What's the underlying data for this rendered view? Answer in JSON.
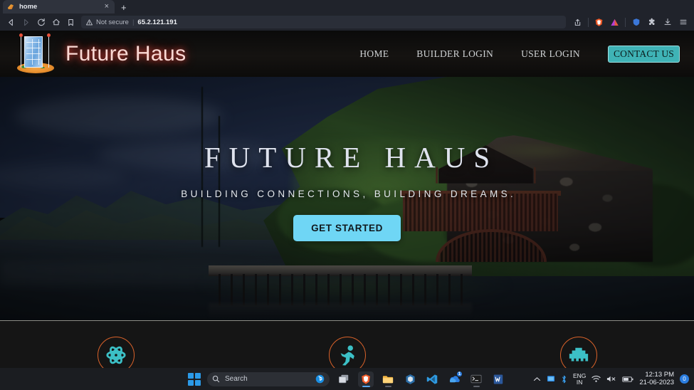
{
  "browser": {
    "tab": {
      "title": "home",
      "close_label": "×",
      "favicon": "brave-lion-favicon"
    },
    "newtab_label": "+",
    "nav": {
      "back": "back-arrow-icon",
      "forward": "forward-arrow-icon",
      "reload": "reload-icon",
      "home": "home-icon",
      "bookmark": "bookmark-icon"
    },
    "omnibox": {
      "security_label": "Not secure",
      "separator": "|",
      "url": "65.2.121.191"
    },
    "toolbar_right": {
      "share": "share-icon",
      "brave": "brave-lion-icon",
      "extension_a": "triangle-extension-icon",
      "shield": "brave-shield-icon",
      "extensions": "puzzle-piece-icon",
      "downloads": "download-icon",
      "menu": "hamburger-menu-icon"
    }
  },
  "site": {
    "brand": {
      "name": "Future Haus",
      "logo": "building-tower-logo"
    },
    "nav_links": [
      {
        "label": "HOME"
      },
      {
        "label": "BUILDER LOGIN"
      },
      {
        "label": "USER LOGIN"
      }
    ],
    "cta": {
      "label": "CONTACT US"
    },
    "hero": {
      "title": "FUTURE HAUS",
      "subtitle": "BUILDING CONNECTIONS, BUILDING DREAMS.",
      "button": "GET STARTED",
      "image_description": "lakeside stone boathouse at dusk with wooden jetty and forested hillside"
    },
    "features": [
      {
        "icon": "atom-icon"
      },
      {
        "icon": "running-person-icon"
      },
      {
        "icon": "building-blocks-icon"
      }
    ]
  },
  "colors": {
    "brand_text": "#fbd9d4",
    "cta_bg": "#3fb3b6",
    "hero_button_bg": "#6fd6f5",
    "feature_ring": "#d9622a",
    "feature_icon": "#3cc0c6",
    "header_bg": "#0d0d0d",
    "features_bg": "#151515"
  },
  "taskbar": {
    "start": "windows-start-icon",
    "search_placeholder": "Search",
    "search_icon": "search-icon",
    "copilot_icon": "bing-copilot-icon",
    "apps": [
      {
        "name": "task-view-icon"
      },
      {
        "name": "brave-browser-icon"
      },
      {
        "name": "file-explorer-icon"
      },
      {
        "name": "virtualbox-icon"
      },
      {
        "name": "vs-code-icon"
      },
      {
        "name": "onedrive-icon",
        "badge": "1"
      },
      {
        "name": "terminal-icon"
      },
      {
        "name": "word-icon"
      }
    ],
    "tray": {
      "chevron": "show-hidden-icons-chevron",
      "monitor": "display-icon",
      "bluetooth": "bluetooth-icon",
      "language_top": "ENG",
      "language_bottom": "IN",
      "wifi": "wifi-icon",
      "volume": "volume-muted-icon",
      "battery": "battery-icon",
      "time": "12:13 PM",
      "date": "21-06-2023",
      "notification_count": "0"
    }
  }
}
